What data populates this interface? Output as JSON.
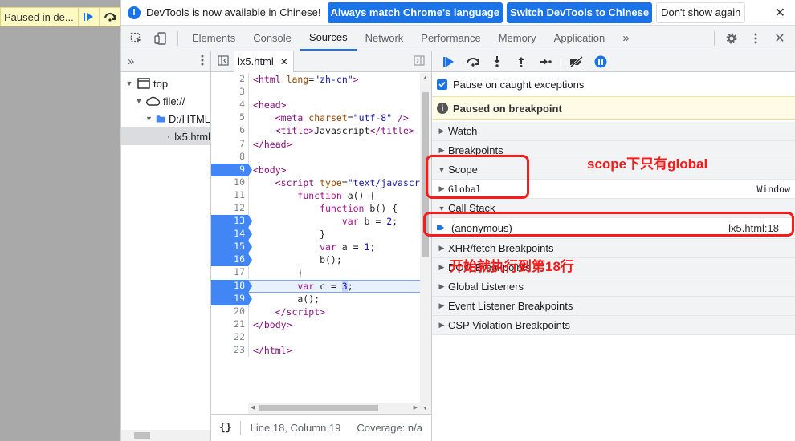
{
  "page": {
    "paused_pill_text": "Paused in de...",
    "pill_resume_icon": "resume-icon",
    "pill_step_icon": "step-over-icon"
  },
  "infobar": {
    "message": "DevTools is now available in Chinese!",
    "btn_match": "Always match Chrome's language",
    "btn_switch": "Switch DevTools to Chinese",
    "btn_dont_show": "Don't show again"
  },
  "tabs": [
    "Elements",
    "Console",
    "Sources",
    "Network",
    "Performance",
    "Memory",
    "Application"
  ],
  "active_tab": "Sources",
  "navigator": {
    "tree": [
      {
        "label": "top",
        "icon": "frame-icon"
      },
      {
        "label": "file://",
        "icon": "cloud-icon"
      },
      {
        "label": "D:/HTML",
        "icon": "folder-icon"
      },
      {
        "label": "lx5.html",
        "icon": "file-icon"
      }
    ]
  },
  "editor": {
    "file_name": "lx5.html",
    "lines": [
      {
        "n": "2",
        "bp": false,
        "exec": false,
        "html": "<span class='tag'>&lt;html</span> <span class='attr'>lang</span>=<span class='str'>\"zh-cn\"</span><span class='tag'>&gt;</span>"
      },
      {
        "n": "3",
        "bp": false,
        "exec": false,
        "html": ""
      },
      {
        "n": "4",
        "bp": false,
        "exec": false,
        "html": "<span class='tag'>&lt;head&gt;</span>"
      },
      {
        "n": "5",
        "bp": false,
        "exec": false,
        "html": "    <span class='tag'>&lt;meta</span> <span class='attr'>charset</span>=<span class='str'>\"utf-8\"</span> <span class='tag'>/&gt;</span>"
      },
      {
        "n": "6",
        "bp": false,
        "exec": false,
        "html": "    <span class='tag'>&lt;title&gt;</span>Javascript<span class='tag'>&lt;/title&gt;</span>"
      },
      {
        "n": "7",
        "bp": false,
        "exec": false,
        "html": "<span class='tag'>&lt;/head&gt;</span>"
      },
      {
        "n": "8",
        "bp": false,
        "exec": false,
        "html": ""
      },
      {
        "n": "9",
        "bp": true,
        "exec": false,
        "html": "<span class='tag'>&lt;body&gt;</span>"
      },
      {
        "n": "10",
        "bp": false,
        "exec": false,
        "html": "    <span class='tag'>&lt;script</span> <span class='attr'>type</span>=<span class='str'>\"text/javascript\"</span><span class='tag'>&gt;</span>"
      },
      {
        "n": "11",
        "bp": false,
        "exec": false,
        "html": "        <span class='kw'>function</span> a() {"
      },
      {
        "n": "12",
        "bp": false,
        "exec": false,
        "html": "            <span class='kw'>function</span> b() {"
      },
      {
        "n": "13",
        "bp": true,
        "exec": false,
        "html": "                <span class='kw'>var</span> b = <span class='num'>2</span>;"
      },
      {
        "n": "14",
        "bp": true,
        "exec": false,
        "html": "            }"
      },
      {
        "n": "15",
        "bp": true,
        "exec": false,
        "html": "            <span class='kw'>var</span> a = <span class='num'>1</span>;"
      },
      {
        "n": "16",
        "bp": true,
        "exec": false,
        "html": "            b();"
      },
      {
        "n": "17",
        "bp": false,
        "exec": false,
        "html": "        }"
      },
      {
        "n": "18",
        "bp": true,
        "exec": true,
        "html": "        <span class='kw'>var</span> c = <span class='num hl'>3</span>;"
      },
      {
        "n": "19",
        "bp": true,
        "exec": false,
        "html": "        a();"
      },
      {
        "n": "20",
        "bp": false,
        "exec": false,
        "html": "    <span class='tag'>&lt;/script&gt;</span>"
      },
      {
        "n": "21",
        "bp": false,
        "exec": false,
        "html": "<span class='tag'>&lt;/body&gt;</span>"
      },
      {
        "n": "22",
        "bp": false,
        "exec": false,
        "html": ""
      },
      {
        "n": "23",
        "bp": false,
        "exec": false,
        "html": "<span class='tag'>&lt;/html&gt;</span>"
      }
    ],
    "status_position": "Line 18, Column 19",
    "status_coverage": "Coverage: n/a",
    "format_icon": "{}"
  },
  "debugger": {
    "pause_on_caught": "Pause on caught exceptions",
    "paused_banner": "Paused on breakpoint",
    "sections": {
      "watch": "Watch",
      "breakpoints": "Breakpoints",
      "scope": "Scope",
      "scope_global": "Global",
      "scope_global_value": "Window",
      "call_stack": "Call Stack",
      "frame_name": "(anonymous)",
      "frame_location": "lx5.html:18",
      "xhr": "XHR/fetch Breakpoints",
      "dom": "DOM Breakpoints",
      "global_listeners": "Global Listeners",
      "event_listener": "Event Listener Breakpoints",
      "csp": "CSP Violation Breakpoints"
    }
  },
  "annotations": {
    "scope_note": "scope下只有global",
    "line_note": "开始就执行到第18行"
  },
  "colors": {
    "accent": "#1a73e8",
    "breakpoint": "#4285f4",
    "annotation": "#ff1a1a",
    "paused_bg": "#fffbe6"
  }
}
